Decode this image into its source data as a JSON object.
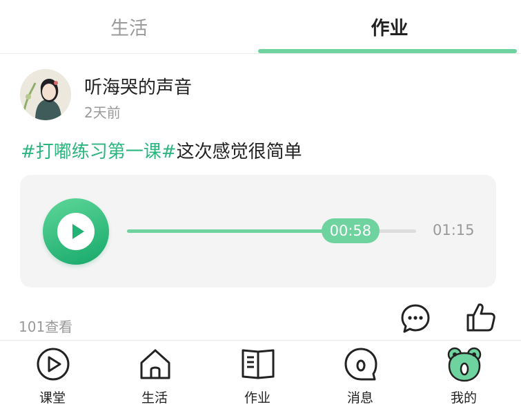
{
  "tabs": {
    "life": "生活",
    "homework": "作业",
    "active": "homework"
  },
  "post": {
    "username": "听海哭的声音",
    "time": "2天前",
    "topic": "#打嘟练习第一课#",
    "text": "这次感觉很简单",
    "views": "101查看"
  },
  "audio": {
    "current": "00:58",
    "duration": "01:15",
    "progress": 0.773
  },
  "nav": {
    "items": [
      {
        "label": "课堂",
        "icon": "play-circle-icon"
      },
      {
        "label": "生活",
        "icon": "home-icon"
      },
      {
        "label": "作业",
        "icon": "book-icon"
      },
      {
        "label": "消息",
        "icon": "message-bubble-icon"
      },
      {
        "label": "我的",
        "icon": "frog-face-icon"
      }
    ]
  },
  "colors": {
    "accent": "#6ed39e",
    "accent_dark": "#16a86a",
    "topic": "#2bb57f",
    "muted": "#999999"
  }
}
